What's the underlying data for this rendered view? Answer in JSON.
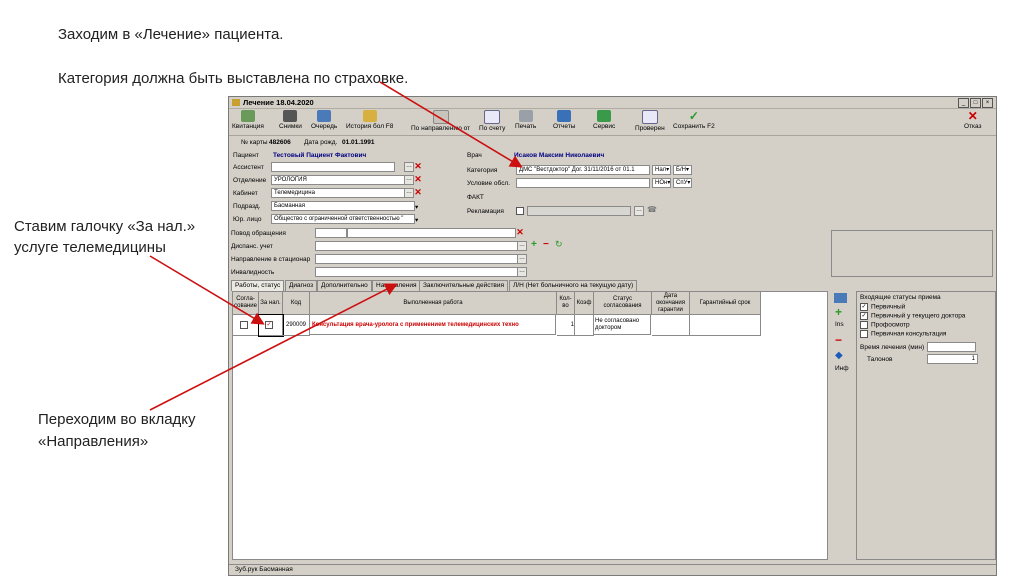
{
  "annotations": {
    "line1": "Заходим в «Лечение» пациента.",
    "line2": "Категория должна быть выставлена по страховке.",
    "checkbox_note_1": "Ставим галочку «За нал.»",
    "checkbox_note_2": "услуге телемедицины",
    "tab_note_1": "Переходим во вкладку",
    "tab_note_2": "«Направления»"
  },
  "window": {
    "title": "Лечение 18.04.2020",
    "min": "_",
    "max": "□",
    "close": "×"
  },
  "toolbar": {
    "items": [
      "Квитанция",
      "Снимки",
      "Очередь",
      "История бол F8",
      "По направлению от",
      "По счету",
      "Печать",
      "Отчеты",
      "Сервис",
      "Проверен",
      "Сохранить F2"
    ],
    "exit": "Отказ"
  },
  "card": {
    "card_label": "№ карты",
    "card_no": "482606",
    "dob_label": "Дата рожд.",
    "dob": "01.01.1991"
  },
  "patient": {
    "label": "Пациент",
    "value": "Тестовый Пациент Фактович",
    "doctor_label": "Врач",
    "doctor": "Исаков Максим Николаевич"
  },
  "left_fields": [
    {
      "label": "Ассистент",
      "value": ""
    },
    {
      "label": "Отделение",
      "value": "УРОЛОГИЯ"
    },
    {
      "label": "Кабинет",
      "value": "Телемедицина"
    },
    {
      "label": "Подразд.",
      "value": "Басманная"
    },
    {
      "label": "Юр. лицо",
      "value": "Общество с ограниченной ответственностью \""
    }
  ],
  "right_fields": {
    "category_label": "Категория",
    "category_value": "ДМС \"Вестдоктор\" Дог. 31/11/2016 от 01.1",
    "nal": "Нал▾",
    "bn": "Б/Н▾",
    "conditions_label": "Условие обсл.",
    "hos": "НОн▾",
    "spu": "СпУ▾",
    "fact_label": "ФАКТ",
    "reclamation_label": "Рекламация"
  },
  "middle_fields": [
    {
      "label": "Повод обращения"
    },
    {
      "label": "Диспанс. учет"
    },
    {
      "label": "Направление в стационар"
    },
    {
      "label": "Инвалидность"
    }
  ],
  "tabs": [
    "Работы, статус",
    "Диагноз",
    "Дополнительно",
    "Направления",
    "Заключительные действия",
    "Л/Н (Нет больничного на текущую дату)"
  ],
  "grid": {
    "headers": [
      "Согла-сование",
      "За нал.",
      "Код",
      "Выполненная работа",
      "Кол-во",
      "Коэф",
      "Статус согласования",
      "Дата окончания гарантии",
      "Гарантийный срок"
    ],
    "rows": [
      {
        "code": "290009",
        "work": "Консультация врача-уролога с применением телемедицинских техно",
        "qty": "1",
        "coef": "",
        "status": "Не согласовано доктором",
        "warranty_end": "",
        "warranty": ""
      }
    ]
  },
  "side_buttons": {
    "ins": "Ins",
    "info": "Инф"
  },
  "right_panel": {
    "title": "Входящие статусы приема",
    "options": [
      {
        "label": "Первичный",
        "checked": true
      },
      {
        "label": "Первичный у текущего доктора",
        "checked": true
      },
      {
        "label": "Профосмотр",
        "checked": false
      },
      {
        "label": "Первичная консультация",
        "checked": false
      }
    ],
    "time_label": "Время лечения (мин)",
    "time_value": "",
    "coupons_label": "Талонов",
    "coupons_value": "1"
  },
  "statusbar": {
    "text": "Зуб.рук Басманная"
  },
  "colors": {
    "accent_red": "#cc0000",
    "window_bg": "#d4d0c8",
    "patient_blue": "#000080"
  }
}
